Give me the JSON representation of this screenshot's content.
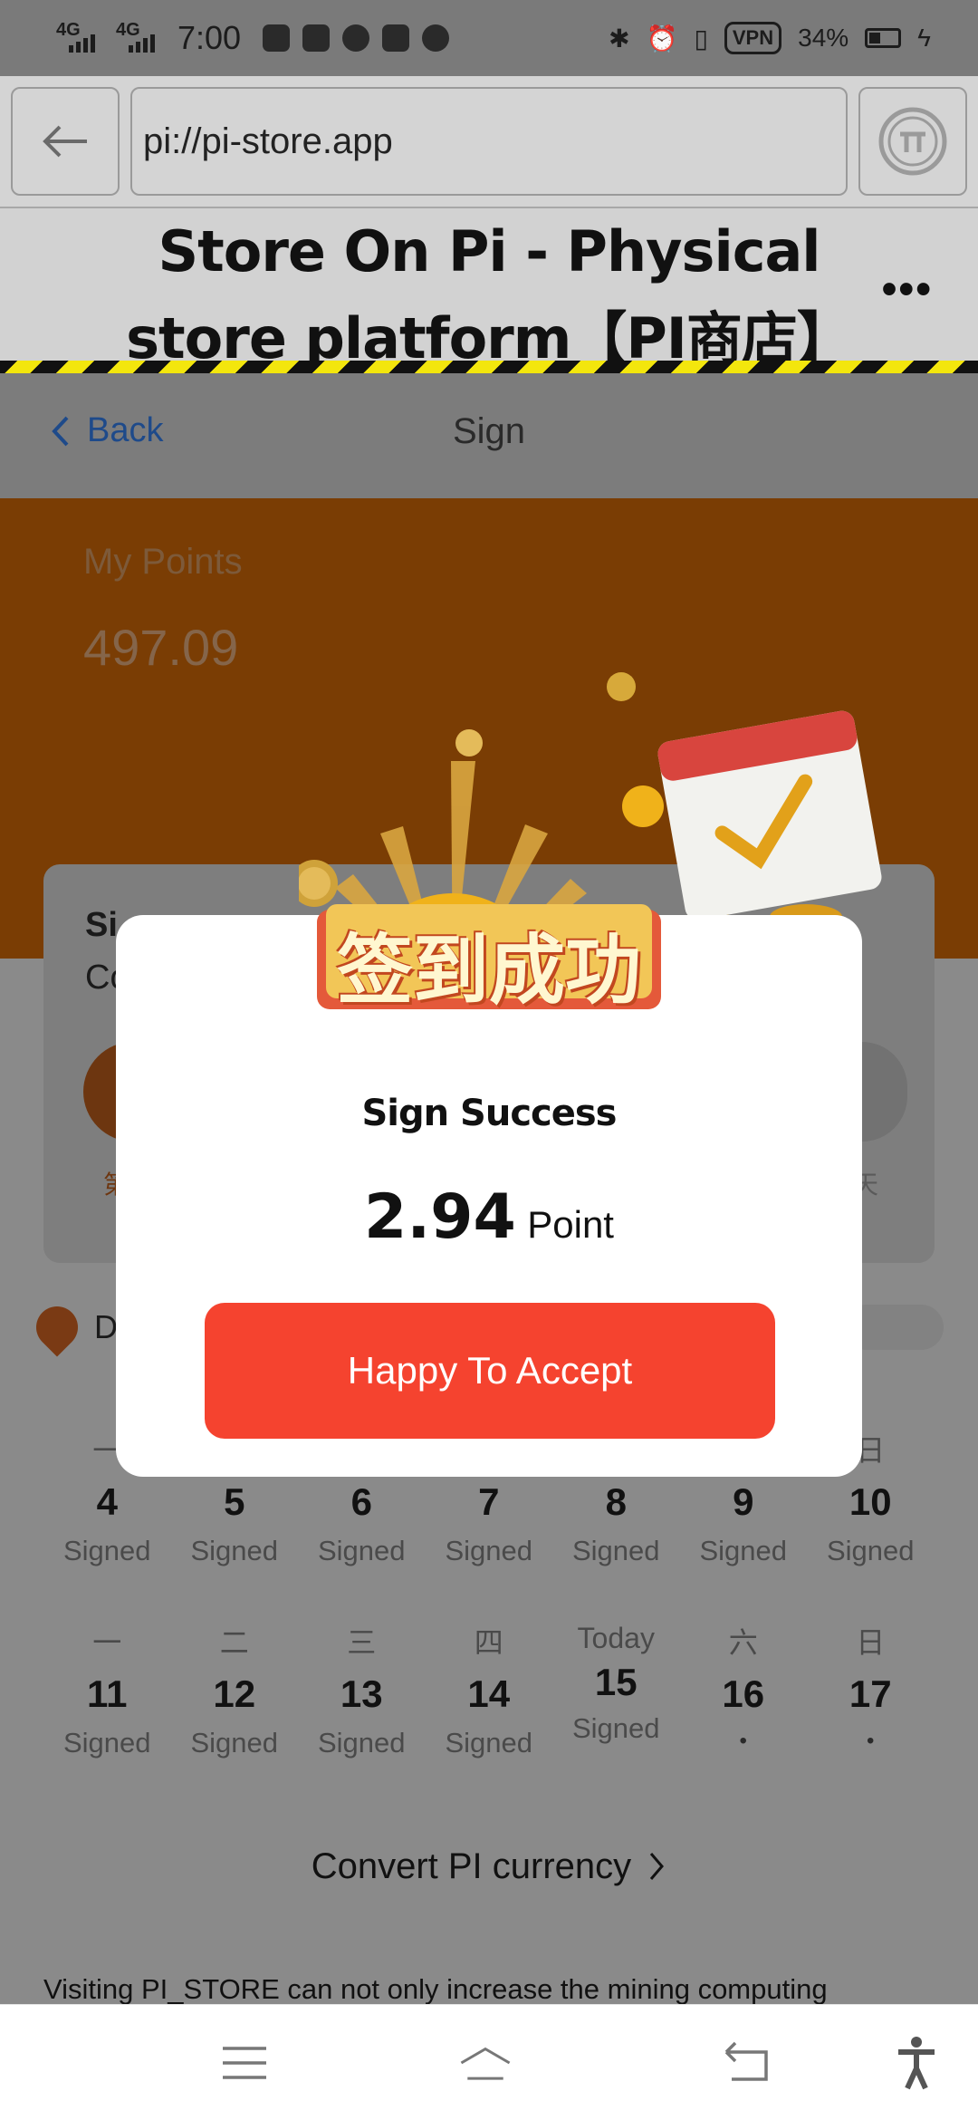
{
  "status_bar": {
    "network_1": "4G",
    "network_2": "4G",
    "time": "7:00",
    "vpn": "VPN",
    "battery": "34%",
    "icons": [
      "zalo-icon",
      "messenger-icon",
      "youtube-icon",
      "shield-icon",
      "bluetooth-icon",
      "alarm-icon",
      "vibrate-icon",
      "charging-icon"
    ]
  },
  "browser": {
    "url": "pi://pi-store.app",
    "title_line1": "Store On Pi - Physical",
    "title_line2": "store platform【PI商店】",
    "more_label": "•••"
  },
  "nav": {
    "back_label": "Back",
    "title": "Sign"
  },
  "points": {
    "label": "My Points",
    "value": "497.09"
  },
  "card": {
    "line1": "Si",
    "line2": "Co",
    "tag_left": "第",
    "tag_right": "天"
  },
  "daily_label": "D",
  "calendar": {
    "week1": [
      {
        "weekday": "一",
        "day": "4",
        "status": "Signed"
      },
      {
        "weekday": "",
        "day": "5",
        "status": "Signed"
      },
      {
        "weekday": "",
        "day": "6",
        "status": "Signed"
      },
      {
        "weekday": "",
        "day": "7",
        "status": "Signed"
      },
      {
        "weekday": "",
        "day": "8",
        "status": "Signed"
      },
      {
        "weekday": "",
        "day": "9",
        "status": "Signed"
      },
      {
        "weekday": "日",
        "day": "10",
        "status": "Signed"
      }
    ],
    "week2": [
      {
        "weekday": "一",
        "day": "11",
        "status": "Signed"
      },
      {
        "weekday": "二",
        "day": "12",
        "status": "Signed"
      },
      {
        "weekday": "三",
        "day": "13",
        "status": "Signed"
      },
      {
        "weekday": "四",
        "day": "14",
        "status": "Signed"
      },
      {
        "weekday": "Today",
        "day": "15",
        "status": "Signed"
      },
      {
        "weekday": "六",
        "day": "16",
        "status": "•"
      },
      {
        "weekday": "日",
        "day": "17",
        "status": "•"
      }
    ]
  },
  "convert_label": "Convert PI currency",
  "visiting_text": "Visiting PI_STORE can not only increase the mining computing",
  "modal": {
    "banner_text": "签到成功",
    "message": "Sign Success",
    "points_value": "2.94",
    "points_unit": "Point",
    "accept_label": "Happy To Accept"
  },
  "colors": {
    "accept": "#f5432f",
    "banner_orange": "#e8760c",
    "overlay": "rgba(0,0,0,0.45)"
  }
}
